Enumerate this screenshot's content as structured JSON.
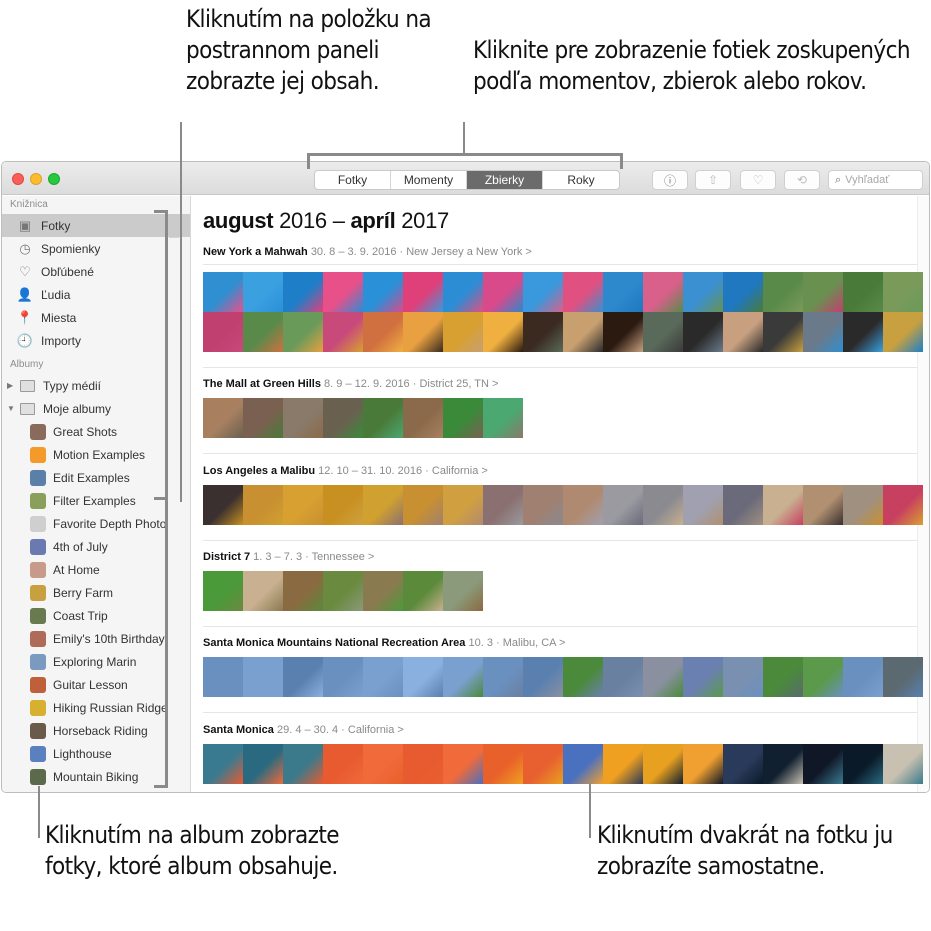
{
  "callouts": {
    "sidebar": "Kliknutím na položku na postrannom paneli zobrazte jej obsah.",
    "views": "Kliknite pre zobrazenie fotiek zoskupených podľa momentov, zbierok alebo rokov.",
    "album": "Kliknutím na album zobrazte fotky, ktoré album obsahuje.",
    "photo": "Kliknutím dvakrát na fotku ju zobrazíte samostatne."
  },
  "toolbar": {
    "views": [
      {
        "label": "Fotky",
        "active": false
      },
      {
        "label": "Momenty",
        "active": false
      },
      {
        "label": "Zbierky",
        "active": true
      },
      {
        "label": "Roky",
        "active": false
      }
    ],
    "buttons": [
      {
        "name": "info-button",
        "icon": "info-icon",
        "glyph": "ⓘ"
      },
      {
        "name": "share-button",
        "icon": "share-icon",
        "glyph": "⇧"
      },
      {
        "name": "favorite-button",
        "icon": "heart-icon",
        "glyph": "♡"
      },
      {
        "name": "rotate-button",
        "icon": "rotate-icon",
        "glyph": "⟲"
      }
    ],
    "search_placeholder": "Vyhľadať"
  },
  "sidebar": {
    "library_heading": "Knižnica",
    "library": [
      {
        "label": "Fotky",
        "icon": "photos-icon",
        "glyph": "▣",
        "selected": true
      },
      {
        "label": "Spomienky",
        "icon": "memories-icon",
        "glyph": "◷"
      },
      {
        "label": "Obľúbené",
        "icon": "heart-icon",
        "glyph": "♡"
      },
      {
        "label": "Ľudia",
        "icon": "person-icon",
        "glyph": "👤"
      },
      {
        "label": "Miesta",
        "icon": "pin-icon",
        "glyph": "📍"
      },
      {
        "label": "Importy",
        "icon": "clock-icon",
        "glyph": "🕘"
      }
    ],
    "albums_heading": "Albumy",
    "groups": [
      {
        "label": "Typy médií",
        "expanded": false
      },
      {
        "label": "Moje albumy",
        "expanded": true
      }
    ],
    "albums": [
      {
        "label": "Great Shots",
        "color": "#8a6a5a"
      },
      {
        "label": "Motion Examples",
        "color": "#f39a2a"
      },
      {
        "label": "Edit Examples",
        "color": "#5a7fa8"
      },
      {
        "label": "Filter Examples",
        "color": "#8aa05a"
      },
      {
        "label": "Favorite Depth Photo",
        "color": "#cfcfcf"
      },
      {
        "label": "4th of July",
        "color": "#6a7ab0"
      },
      {
        "label": "At Home",
        "color": "#c89a8a"
      },
      {
        "label": "Berry Farm",
        "color": "#c8a040"
      },
      {
        "label": "Coast Trip",
        "color": "#6a7a50"
      },
      {
        "label": "Emily's 10th Birthday",
        "color": "#b06a5a"
      },
      {
        "label": "Exploring Marin",
        "color": "#7a9ac0"
      },
      {
        "label": "Guitar Lesson",
        "color": "#c0603a"
      },
      {
        "label": "Hiking Russian Ridge",
        "color": "#d8b030"
      },
      {
        "label": "Horseback Riding",
        "color": "#6a5a4a"
      },
      {
        "label": "Lighthouse",
        "color": "#5a80c0"
      },
      {
        "label": "Mountain Biking",
        "color": "#5a6a4a"
      }
    ]
  },
  "main": {
    "title_month1": "august",
    "title_year1": "2016",
    "title_dash": "–",
    "title_month2": "apríl",
    "title_year2": "2017",
    "moments": [
      {
        "title": "New York a Mahwah",
        "meta": "30. 8 – 3. 9. 2016 · New Jersey a New York >",
        "count": 36,
        "colors": [
          "#2f8fd0",
          "#3ba0e0",
          "#1e7fc8",
          "#e8508a",
          "#2a90d8",
          "#e0407a",
          "#2c8cd4",
          "#d84a8a",
          "#3a98dc",
          "#e05080",
          "#2e88cc",
          "#d8608a",
          "#3a90d0",
          "#1f78c0",
          "#5a8a4a",
          "#6a9050",
          "#4a7a3a",
          "#7a9a5a",
          "#c04070",
          "#5a8a4a",
          "#6a9a5a",
          "#c84a7a",
          "#d07040",
          "#e8a040",
          "#d8a030",
          "#f0b040",
          "#3a2a20",
          "#c8a070",
          "#2a1a10",
          "#5a6a5a",
          "#2a2a2a",
          "#c8a080",
          "#3a3a3a",
          "#6a7a8a",
          "#2a2a2a",
          "#c8a040"
        ]
      },
      {
        "title": "The Mall at Green Hills",
        "meta": "8. 9 – 12. 9. 2016 · District 25, TN >",
        "count": 8,
        "colors": [
          "#a88060",
          "#7a6050",
          "#8a7a6a",
          "#6a6050",
          "#4a7a3a",
          "#8a6a4a",
          "#3a8a3a",
          "#4aa870"
        ]
      },
      {
        "title": "Los Angeles a Malibu",
        "meta": "12. 10 – 31. 10. 2016 · California >",
        "count": 18,
        "colors": [
          "#3a3030",
          "#c89030",
          "#d8a030",
          "#c89020",
          "#d0a030",
          "#c89030",
          "#d0a040",
          "#8a7070",
          "#a08070",
          "#b08a70",
          "#9a9aa0",
          "#8a8a90",
          "#a0a0b0",
          "#6a6a7a",
          "#c8b090",
          "#b09070",
          "#a09080",
          "#c84060"
        ]
      },
      {
        "title": "District 7",
        "meta": "1. 3 – 7. 3 · Tennessee >",
        "count": 7,
        "colors": [
          "#4a9a3a",
          "#c8b090",
          "#8a6a40",
          "#6a8a40",
          "#8a7a50",
          "#5a8a3a",
          "#8a9a7a"
        ]
      },
      {
        "title": "Santa Monica Mountains National Recreation Area",
        "meta": "10. 3 · Malibu, CA >",
        "count": 18,
        "colors": [
          "#6a90c0",
          "#7aa0d0",
          "#5a80b0",
          "#6a90c0",
          "#7aa0d0",
          "#8ab0e0",
          "#7aa0d0",
          "#6a90c0",
          "#5a80b0",
          "#4a8a3a",
          "#6a80a0",
          "#8a90a0",
          "#6a80b0",
          "#7a90b0",
          "#4a8a3a",
          "#5a9a4a",
          "#6a90c0",
          "#5a6a70"
        ]
      },
      {
        "title": "Santa Monica",
        "meta": "29. 4 – 30. 4 · California >",
        "count": 18,
        "colors": [
          "#3a7a90",
          "#2a6a80",
          "#3a7a8a",
          "#e85a30",
          "#f06a3a",
          "#e85a30",
          "#f06a3a",
          "#e8602a",
          "#e86030",
          "#4a70c0",
          "#f0a020",
          "#e8a020",
          "#f0a030",
          "#2a3a5a",
          "#102030",
          "#101828",
          "#0a1a28",
          "#c8c0b0"
        ]
      }
    ]
  }
}
